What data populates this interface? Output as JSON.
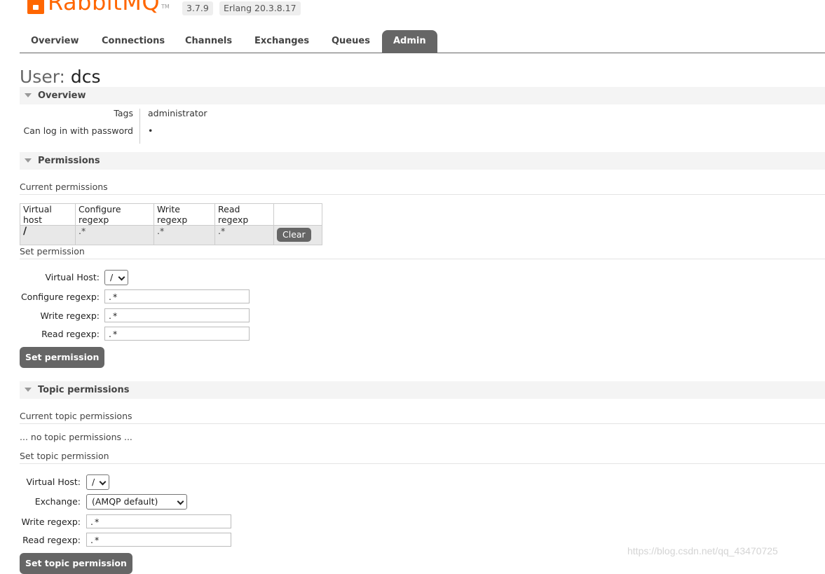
{
  "header": {
    "logo_brand": "RabbitMQ",
    "logo_tm": "TM",
    "version": "3.7.9",
    "erlang": "Erlang 20.3.8.17"
  },
  "tabs": [
    {
      "label": "Overview",
      "active": false
    },
    {
      "label": "Connections",
      "active": false
    },
    {
      "label": "Channels",
      "active": false
    },
    {
      "label": "Exchanges",
      "active": false
    },
    {
      "label": "Queues",
      "active": false
    },
    {
      "label": "Admin",
      "active": true
    }
  ],
  "page": {
    "title_prefix": "User:",
    "user": "dcs"
  },
  "overview": {
    "header": "Overview",
    "tags_label": "Tags",
    "tags_value": "administrator",
    "login_label": "Can log in with password",
    "login_value": "•"
  },
  "permissions": {
    "header": "Permissions",
    "current_label": "Current permissions",
    "columns": [
      "Virtual host",
      "Configure regexp",
      "Write regexp",
      "Read regexp"
    ],
    "rows": [
      {
        "vhost": "/",
        "configure": ".*",
        "write": ".*",
        "read": ".*",
        "action": "Clear"
      }
    ],
    "set_label": "Set permission",
    "form": {
      "vhost_label": "Virtual Host:",
      "vhost_value": "/",
      "configure_label": "Configure regexp:",
      "configure_value": ".*",
      "write_label": "Write regexp:",
      "write_value": ".*",
      "read_label": "Read regexp:",
      "read_value": ".*",
      "submit": "Set permission"
    }
  },
  "topic": {
    "header": "Topic permissions",
    "current_label": "Current topic permissions",
    "empty": "... no topic permissions ...",
    "set_label": "Set topic permission",
    "form": {
      "vhost_label": "Virtual Host:",
      "vhost_value": "/",
      "exchange_label": "Exchange:",
      "exchange_value": "(AMQP default)",
      "write_label": "Write regexp:",
      "write_value": ".*",
      "read_label": "Read regexp:",
      "read_value": ".*",
      "submit": "Set topic permission"
    }
  },
  "watermark": "https://blog.csdn.net/qq_43470725"
}
